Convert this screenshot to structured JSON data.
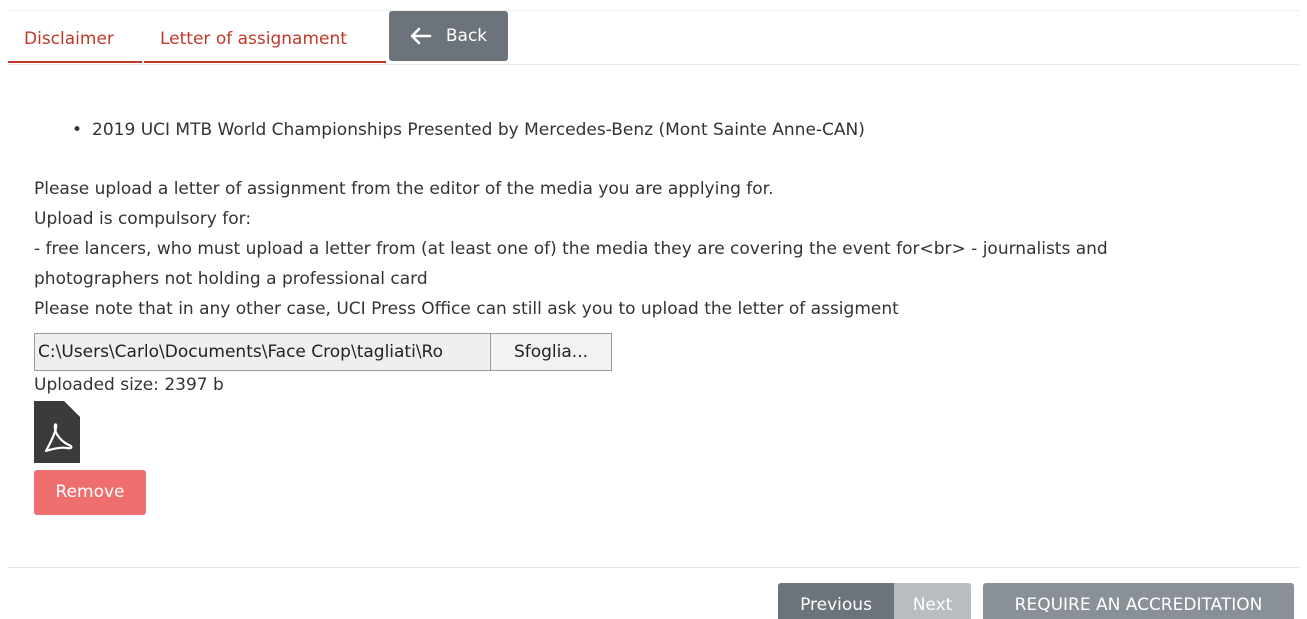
{
  "tabs": [
    {
      "label": "Disclaimer"
    },
    {
      "label": "Letter of assignament"
    }
  ],
  "back_button": {
    "label": "Back",
    "icon": "arrow-left-icon"
  },
  "event": {
    "bullet": "•",
    "name": "2019 UCI MTB World Championships Presented by Mercedes-Benz (Mont Sainte Anne-CAN)"
  },
  "instructions": {
    "line1": "Please upload a letter of assignment from the editor of the media you are applying for.",
    "line2": "Upload is compulsory for:",
    "line3": "- free lancers, who must upload a letter from (at least one of) the media they are covering the event for<br> - journalists and",
    "line4": "photographers not holding a professional card",
    "line5": "Please note that in any other case, UCI Press Office can still ask you to upload the letter of assigment"
  },
  "file_upload": {
    "value": "C:\\Users\\Carlo\\Documents\\Face Crop\\tagliati\\Ro",
    "browse_label": "Sfoglia..."
  },
  "uploaded_size": "Uploaded size: 2397 b",
  "file_icon": "pdf-file-icon",
  "remove_button": {
    "label": "Remove"
  },
  "footer": {
    "previous_label": "Previous",
    "next_label": "Next",
    "accreditation_label": "REQUIRE AN ACCREDITATION"
  },
  "colors": {
    "tab_accent": "#c0392b",
    "back_button": "#6c737b",
    "remove_button": "#ef6f6f",
    "previous_button": "#6c737b",
    "next_button_disabled": "#b9bcc0",
    "accreditation_button": "#8a9097"
  }
}
